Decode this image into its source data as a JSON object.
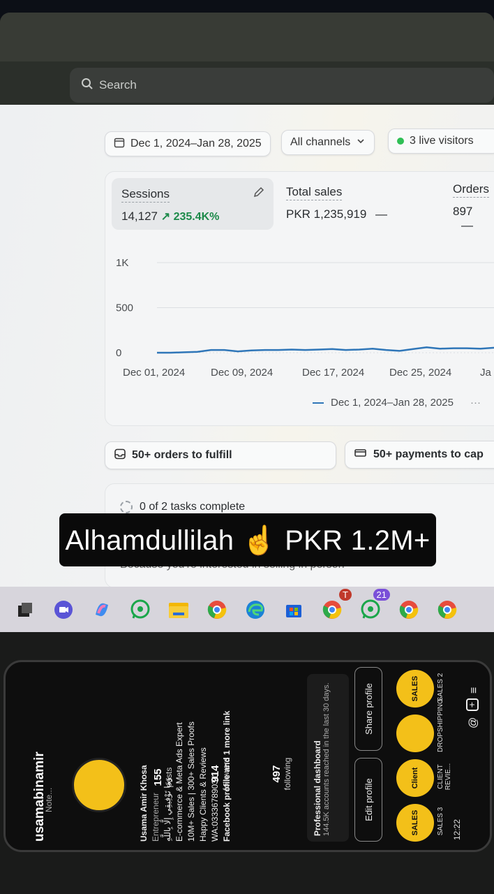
{
  "search": {
    "placeholder": "Search"
  },
  "filters": {
    "date_range": "Dec 1, 2024–Jan 28, 2025",
    "channels": "All channels",
    "live_visitors": "3 live visitors"
  },
  "metrics": {
    "sessions": {
      "label": "Sessions",
      "value": "14,127",
      "change": "↗ 235.4K%"
    },
    "total_sales": {
      "label": "Total sales",
      "value": "PKR 1,235,919",
      "trend": "—"
    },
    "orders": {
      "label": "Orders",
      "value": "897",
      "trend": "—"
    }
  },
  "chart_data": {
    "type": "line",
    "x_tick_labels": [
      "Dec 01, 2024",
      "Dec 09, 2024",
      "Dec 17, 2024",
      "Dec 25, 2024",
      "Ja"
    ],
    "y_tick_labels": [
      "1K",
      "500",
      "0"
    ],
    "ylim": [
      0,
      1000
    ],
    "series": [
      {
        "name": "Dec 1, 2024–Jan 28, 2025",
        "values": [
          0,
          0,
          5,
          10,
          30,
          30,
          15,
          25,
          30,
          30,
          35,
          30,
          35,
          40,
          30,
          35,
          45,
          30,
          20,
          40,
          60,
          45,
          50,
          50,
          45,
          55
        ]
      }
    ],
    "legend_text": "Dec 1, 2024–Jan 28, 2025",
    "legend_more": "···",
    "grid": true
  },
  "tasks": {
    "orders_to_fulfill": "50+ orders to fulfill",
    "payments_to_capture": "50+ payments to cap",
    "progress": "0 of 2 tasks complete",
    "hidden_line": "Because you're interested in selling in person"
  },
  "caption": {
    "text": "Alhamdullilah ☝️ PKR 1.2M+"
  },
  "taskbar": {
    "whatsapp_badge": "21",
    "chrome_badge": "T"
  },
  "phone": {
    "status_time": "12:22",
    "username": "usamabinamir",
    "posts_count": "155",
    "posts_label": "posts",
    "followers_count": "914",
    "followers_label": "followers",
    "following_count": "497",
    "following_label": "following",
    "note": "Note...",
    "name": "Usama Amir Khosa",
    "category": "Entrepreneur",
    "bio1": "وَمَا تَوْفِيقِي إِلَّا بِاللَّهِ",
    "bio2": "E-commerce & Meta Ads Expert",
    "bio3": "10M+ Sales | 300+ Sales Proofs",
    "bio4": "Happy Clients & Reviews",
    "bio5": "WA:03336789031",
    "bio6": "Facebook profile and 1 more link",
    "dashboard_title": "Professional dashboard",
    "dashboard_sub": "144.5K accounts reached in the last 30 days.",
    "edit_profile": "Edit profile",
    "share_profile": "Share profile",
    "highlights": [
      {
        "icon_text": "SALES",
        "label": "SALES 3"
      },
      {
        "icon_text": "Client",
        "label": "CLIENT REVIE..."
      },
      {
        "icon_text": "",
        "label": "DROPSHIPPING"
      },
      {
        "icon_text": "SALES",
        "label": "SALES 2"
      }
    ]
  },
  "colors": {
    "accent_green": "#1d8a4a",
    "line_blue": "#2f76b8",
    "banner_bg": "#0a0a0a",
    "highlight_yellow": "#f3c019"
  }
}
